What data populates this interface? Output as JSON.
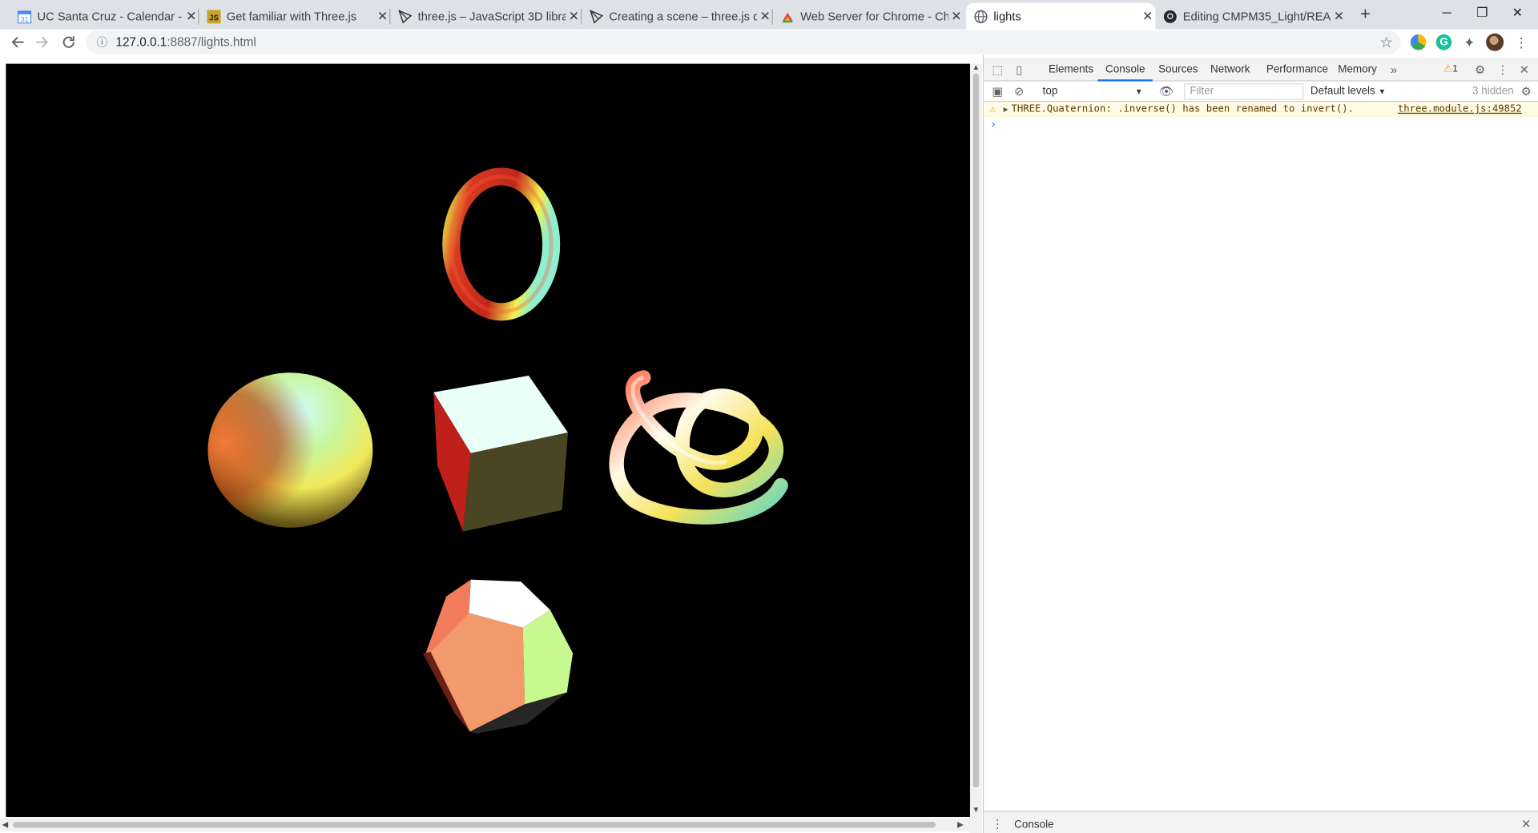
{
  "tabs": [
    {
      "title": "UC Santa Cruz - Calendar - N",
      "icon": "calendar-icon"
    },
    {
      "title": "Get familiar with Three.js",
      "icon": "js-icon"
    },
    {
      "title": "three.js – JavaScript 3D library",
      "icon": "threejs-icon"
    },
    {
      "title": "Creating a scene – three.js do",
      "icon": "threejs-icon"
    },
    {
      "title": "Web Server for Chrome - Chr",
      "icon": "chrome-webstore-icon"
    },
    {
      "title": "lights",
      "icon": "globe-icon"
    },
    {
      "title": "Editing CMPM35_Light/READM",
      "icon": "github-icon"
    }
  ],
  "address": {
    "host": "127.0.0.1",
    "rest": ":8887/lights.html"
  },
  "devtools": {
    "tabs": [
      "Elements",
      "Console",
      "Sources",
      "Network",
      "Performance",
      "Memory"
    ],
    "active_tab": "Console",
    "warn_count": "1",
    "context": "top",
    "filter_placeholder": "Filter",
    "levels": "Default levels",
    "hidden_count": "3 hidden",
    "messages": [
      {
        "level": "warning",
        "text": "THREE.Quaternion: .inverse() has been renamed to invert().",
        "source": "three.module.js:49852"
      }
    ],
    "drawer_tab": "Console"
  },
  "colors": {
    "tab_strip": "#dee1e6",
    "accent": "#1a73e8",
    "warning_bg": "#fffbe5"
  },
  "scene_objects": [
    "torus",
    "sphere",
    "cube",
    "torus-knot",
    "dodecahedron"
  ]
}
